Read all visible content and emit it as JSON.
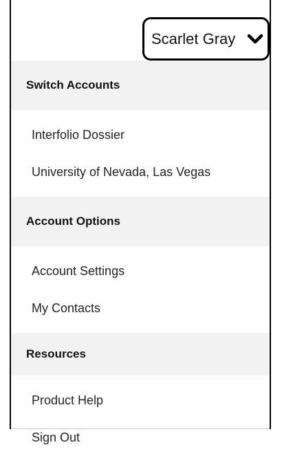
{
  "user": {
    "name": "Scarlet Gray"
  },
  "icons": {
    "toggle": "chevron-down-icon"
  },
  "menu": {
    "switch_accounts": {
      "header": "Switch Accounts",
      "items": [
        "Interfolio Dossier",
        "University of Nevada, Las Vegas"
      ]
    },
    "account_options": {
      "header": "Account Options",
      "items": [
        "Account Settings",
        "My Contacts"
      ]
    },
    "resources": {
      "header": "Resources",
      "items": [
        "Product Help",
        "Sign Out"
      ]
    }
  }
}
